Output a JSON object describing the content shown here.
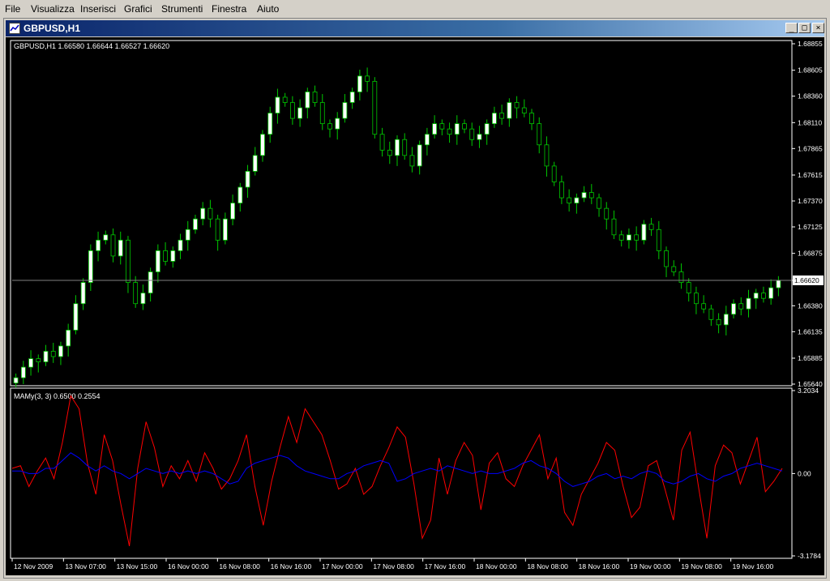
{
  "menu": [
    "File",
    "Visualizza",
    "Inserisci",
    "Grafici",
    "Strumenti",
    "Finestra",
    "Aiuto"
  ],
  "window": {
    "title": "GBPUSD,H1",
    "buttons": {
      "minimize": "_",
      "maximize": "□",
      "close": "×"
    }
  },
  "colors": {
    "background": "#000000",
    "grid_border": "#ffffff",
    "bull_candle": "#ffffff",
    "bear_candle": "#000000",
    "wick": "#00c800",
    "ask_line": "#808080",
    "series_red": "#ff0000",
    "series_blue": "#0000ff",
    "title_bar": "#0a246a"
  },
  "price_panel": {
    "header": "GBPUSD,H1  1.66580 1.66644 1.66527 1.66620",
    "price_labels": [
      "1.68855",
      "1.68605",
      "1.68360",
      "1.68110",
      "1.67865",
      "1.67615",
      "1.67370",
      "1.67125",
      "1.66875",
      "1.66620",
      "1.66380",
      "1.66135",
      "1.65885",
      "1.65640"
    ],
    "current_price": "1.66620"
  },
  "indicator_panel": {
    "header": "MAMy(3, 3) 0.6500 0.2554",
    "labels": [
      "3.2034",
      "0.00",
      "-3.1784"
    ]
  },
  "time_labels": [
    "12 Nov 2009",
    "13 Nov 07:00",
    "13 Nov 15:00",
    "16 Nov 00:00",
    "16 Nov 08:00",
    "16 Nov 16:00",
    "17 Nov 00:00",
    "17 Nov 08:00",
    "17 Nov 16:00",
    "18 Nov 00:00",
    "18 Nov 08:00",
    "18 Nov 16:00",
    "19 Nov 00:00",
    "19 Nov 08:00",
    "19 Nov 16:00"
  ],
  "chart_data": [
    {
      "type": "candlestick",
      "symbol": "GBPUSD",
      "timeframe": "H1",
      "ylim": [
        1.6564,
        1.68855
      ],
      "close_levels": [
        1.657,
        1.658,
        1.6588,
        1.6585,
        1.6595,
        1.659,
        1.66,
        1.6615,
        1.664,
        1.666,
        1.669,
        1.67,
        1.6705,
        1.6685,
        1.67,
        1.666,
        1.664,
        1.665,
        1.667,
        1.669,
        1.668,
        1.669,
        1.67,
        1.671,
        1.672,
        1.673,
        1.672,
        1.67,
        1.672,
        1.6735,
        1.675,
        1.6765,
        1.678,
        1.68,
        1.682,
        1.6835,
        1.683,
        1.6815,
        1.6825,
        1.684,
        1.683,
        1.681,
        1.6805,
        1.6815,
        1.683,
        1.684,
        1.6855,
        1.685,
        1.68,
        1.6785,
        1.678,
        1.6795,
        1.678,
        1.677,
        1.679,
        1.68,
        1.681,
        1.6805,
        1.68,
        1.681,
        1.6805,
        1.6795,
        1.68,
        1.681,
        1.682,
        1.6815,
        1.683,
        1.6825,
        1.682,
        1.681,
        1.679,
        1.677,
        1.6755,
        1.674,
        1.6735,
        1.674,
        1.6745,
        1.674,
        1.673,
        1.672,
        1.6705,
        1.67,
        1.6705,
        1.67,
        1.6715,
        1.671,
        1.669,
        1.6675,
        1.667,
        1.666,
        1.665,
        1.664,
        1.6635,
        1.6625,
        1.662,
        1.663,
        1.664,
        1.6635,
        1.6645,
        1.665,
        1.6645,
        1.6655,
        1.6662
      ]
    },
    {
      "type": "line",
      "title": "MAMy(3, 3) 0.6500 0.2554",
      "ylim": [
        -3.1784,
        3.2034
      ],
      "series": [
        {
          "color": "red",
          "values": [
            0.2,
            0.3,
            -0.5,
            0.1,
            0.6,
            -0.2,
            1.2,
            3.0,
            2.5,
            0.4,
            -0.8,
            1.5,
            0.5,
            -1.2,
            -2.8,
            0.2,
            2.0,
            1.0,
            -0.5,
            0.3,
            -0.2,
            0.5,
            -0.3,
            0.8,
            0.2,
            -0.6,
            -0.2,
            0.5,
            1.5,
            -0.5,
            -2.0,
            -0.3,
            1.0,
            2.2,
            1.2,
            2.5,
            2.0,
            1.5,
            0.5,
            -0.6,
            -0.4,
            0.2,
            -0.8,
            -0.5,
            0.3,
            1.0,
            1.8,
            1.4,
            -0.4,
            -2.5,
            -1.8,
            0.6,
            -0.8,
            0.5,
            1.2,
            0.7,
            -1.4,
            0.4,
            0.8,
            -0.2,
            -0.5,
            0.3,
            0.9,
            1.5,
            -0.2,
            0.6,
            -1.5,
            -2.0,
            -0.8,
            -0.2,
            0.4,
            1.2,
            0.9,
            -0.5,
            -1.7,
            -1.3,
            0.3,
            0.5,
            -0.6,
            -1.8,
            0.9,
            1.6,
            -0.5,
            -2.5,
            0.3,
            1.1,
            0.8,
            -0.4,
            0.5,
            1.4,
            -0.7,
            -0.3,
            0.2
          ]
        },
        {
          "color": "blue",
          "values": [
            0.1,
            0.1,
            0.0,
            0.0,
            0.2,
            0.2,
            0.5,
            0.8,
            0.6,
            0.3,
            0.1,
            0.3,
            0.1,
            0.0,
            -0.2,
            0.0,
            0.2,
            0.1,
            0.0,
            0.1,
            0.0,
            0.1,
            0.0,
            0.1,
            0.0,
            -0.2,
            -0.4,
            -0.3,
            0.2,
            0.4,
            0.5,
            0.6,
            0.7,
            0.6,
            0.3,
            0.1,
            0.0,
            -0.1,
            -0.2,
            -0.2,
            0.0,
            0.1,
            0.3,
            0.4,
            0.5,
            0.4,
            -0.3,
            -0.2,
            0.0,
            0.1,
            0.2,
            0.1,
            0.3,
            0.2,
            0.1,
            0.0,
            0.1,
            0.0,
            0.0,
            0.1,
            0.2,
            0.4,
            0.5,
            0.3,
            0.2,
            0.0,
            -0.3,
            -0.5,
            -0.4,
            -0.3,
            -0.1,
            0.0,
            -0.2,
            -0.1,
            -0.2,
            0.0,
            0.1,
            0.0,
            -0.3,
            -0.4,
            -0.3,
            -0.1,
            0.0,
            -0.2,
            -0.3,
            -0.1,
            0.0,
            0.2,
            0.3,
            0.4,
            0.3,
            0.2,
            0.1
          ]
        }
      ]
    }
  ]
}
